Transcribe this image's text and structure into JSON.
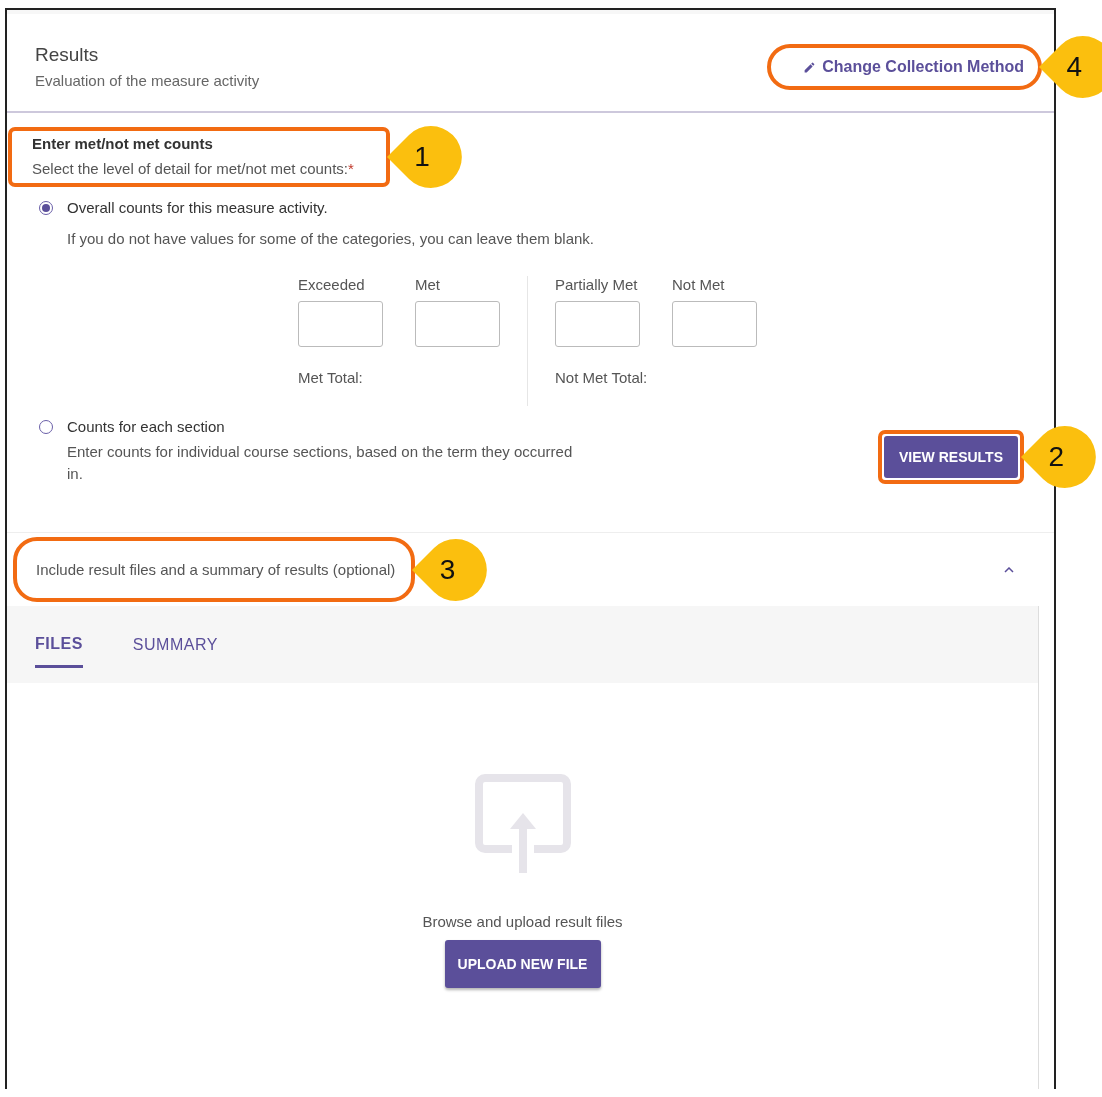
{
  "header": {
    "title": "Results",
    "subtitle": "Evaluation of the measure activity"
  },
  "change_method": {
    "label": "Change Collection Method",
    "callout": "4"
  },
  "counts": {
    "heading": "Enter met/not met counts",
    "prompt": "Select the level of detail for met/not met counts:",
    "required_mark": "*",
    "callout": "1"
  },
  "options": [
    {
      "label": "Overall counts for this measure activity.",
      "description": "If you do not have values for some of the categories, you can leave them blank.",
      "selected": true
    },
    {
      "label": "Counts for each section",
      "description": "Enter counts for individual course sections, based on the term they occurred in.",
      "selected": false
    }
  ],
  "count_groups": [
    {
      "fields": [
        {
          "label": "Exceeded"
        },
        {
          "label": "Met"
        }
      ],
      "total_label": "Met Total:"
    },
    {
      "fields": [
        {
          "label": "Partially Met"
        },
        {
          "label": "Not Met"
        }
      ],
      "total_label": "Not Met Total:"
    }
  ],
  "view_results": {
    "label": "VIEW RESULTS",
    "callout": "2"
  },
  "optional_section": {
    "label": "Include result files and a summary of results (optional)",
    "expanded": true,
    "callout": "3"
  },
  "tabs": [
    {
      "label": "FILES",
      "selected": true
    },
    {
      "label": "SUMMARY",
      "selected": false
    }
  ],
  "upload": {
    "text": "Browse and upload result files",
    "button": "UPLOAD NEW FILE"
  }
}
